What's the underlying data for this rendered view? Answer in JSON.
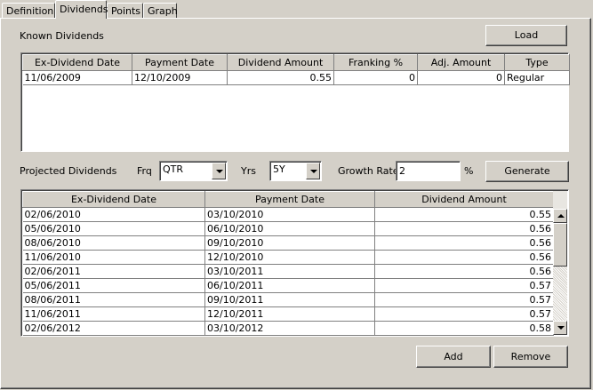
{
  "tabs": [
    {
      "label": "Definition"
    },
    {
      "label": "Dividends"
    },
    {
      "label": "Points"
    },
    {
      "label": "Graph"
    }
  ],
  "known": {
    "title": "Known Dividends",
    "load_label": "Load",
    "columns": [
      "Ex-Dividend Date",
      "Payment Date",
      "Dividend Amount",
      "Franking %",
      "Adj. Amount",
      "Type"
    ],
    "rows": [
      {
        "ex_date": "11/06/2009",
        "pay_date": "12/10/2009",
        "amount": "0.55",
        "franking": "0",
        "adj": "0",
        "type": "Regular"
      }
    ]
  },
  "projected": {
    "title": "Projected Dividends",
    "frq_label": "Frq",
    "frq_value": "QTR",
    "yrs_label": "Yrs",
    "yrs_value": "5Y",
    "growth_label": "Growth Rate",
    "growth_value": "2",
    "percent_label": "%",
    "generate_label": "Generate",
    "columns": [
      "Ex-Dividend Date",
      "Payment Date",
      "Dividend Amount"
    ],
    "rows": [
      {
        "ex_date": "02/06/2010",
        "pay_date": "03/10/2010",
        "amount": "0.55"
      },
      {
        "ex_date": "05/06/2010",
        "pay_date": "06/10/2010",
        "amount": "0.56"
      },
      {
        "ex_date": "08/06/2010",
        "pay_date": "09/10/2010",
        "amount": "0.56"
      },
      {
        "ex_date": "11/06/2010",
        "pay_date": "12/10/2010",
        "amount": "0.56"
      },
      {
        "ex_date": "02/06/2011",
        "pay_date": "03/10/2011",
        "amount": "0.56"
      },
      {
        "ex_date": "05/06/2011",
        "pay_date": "06/10/2011",
        "amount": "0.57"
      },
      {
        "ex_date": "08/06/2011",
        "pay_date": "09/10/2011",
        "amount": "0.57"
      },
      {
        "ex_date": "11/06/2011",
        "pay_date": "12/10/2011",
        "amount": "0.57"
      },
      {
        "ex_date": "02/06/2012",
        "pay_date": "03/10/2012",
        "amount": "0.58"
      }
    ]
  },
  "footer": {
    "add_label": "Add",
    "remove_label": "Remove"
  }
}
